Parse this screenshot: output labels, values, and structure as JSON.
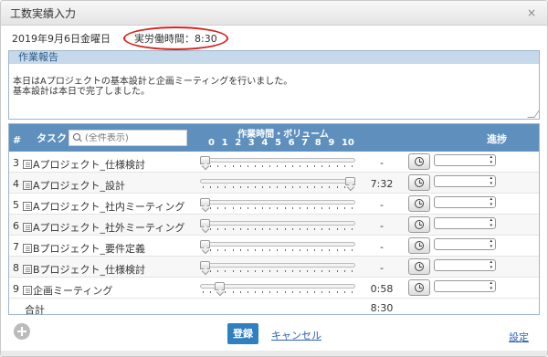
{
  "dialog": {
    "title": "工数実績入力",
    "close_icon": "×"
  },
  "header": {
    "date": "2019年9月6日金曜日",
    "work_time": "実労働時間：8:30"
  },
  "report": {
    "label": "作業報告",
    "text": "本日はAプロジェクトの基本設計と企画ミーティングを行いました。\n基本設計は本日で完了しました。"
  },
  "table": {
    "col_num": "#",
    "col_task": "タスク",
    "search_placeholder": "(全件表示)",
    "col_volume": "作業時間・ボリューム",
    "scale": [
      "0",
      "1",
      "2",
      "3",
      "4",
      "5",
      "6",
      "7",
      "8",
      "9",
      "10"
    ],
    "col_progress": "進捗",
    "rows": [
      {
        "num": "3",
        "name": "Aプロジェクト_仕様検討",
        "volume": 0,
        "time": "-"
      },
      {
        "num": "4",
        "name": "Aプロジェクト_設計",
        "volume": 10,
        "time": "7:32"
      },
      {
        "num": "5",
        "name": "Aプロジェクト_社内ミーティング",
        "volume": 0,
        "time": "-"
      },
      {
        "num": "6",
        "name": "Aプロジェクト_社外ミーティング",
        "volume": 0,
        "time": "-"
      },
      {
        "num": "7",
        "name": "Bプロジェクト_要件定義",
        "volume": 0,
        "time": "-"
      },
      {
        "num": "8",
        "name": "Bプロジェクト_仕様検討",
        "volume": 0,
        "time": "-"
      },
      {
        "num": "9",
        "name": "企画ミーティング",
        "volume": 1,
        "time": "0:58"
      }
    ],
    "total_label": "合計",
    "total_value": "8:30"
  },
  "footer": {
    "save_label": "登録",
    "cancel_label": "キャンセル",
    "settings_label": "設定"
  }
}
